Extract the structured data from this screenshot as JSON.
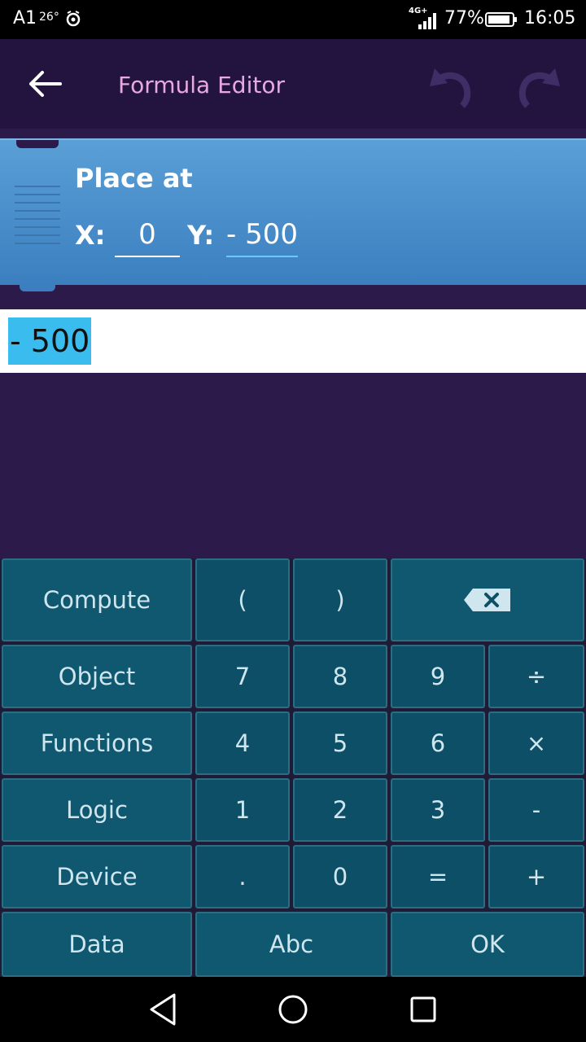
{
  "status_bar": {
    "carrier": "A1",
    "temperature": "26°",
    "network": "4G+",
    "battery_percent": "77%",
    "time": "16:05"
  },
  "app_bar": {
    "title": "Formula Editor",
    "back_icon": "arrow-left-icon",
    "undo_icon": "undo-icon",
    "redo_icon": "redo-icon"
  },
  "brick": {
    "title": "Place at",
    "x_label": "X:",
    "x_value": "0",
    "y_label": "Y:",
    "y_value": "- 500",
    "color": "#4a90cf"
  },
  "formula": {
    "text": "- 500",
    "highlight_color": "#3bbcee"
  },
  "keyboard": {
    "compute": "Compute",
    "paren_open": "(",
    "paren_close": ")",
    "backspace_icon": "backspace-icon",
    "object": "Object",
    "functions": "Functions",
    "logic": "Logic",
    "device": "Device",
    "data": "Data",
    "abc": "Abc",
    "ok": "OK",
    "k7": "7",
    "k8": "8",
    "k9": "9",
    "divide": "÷",
    "k4": "4",
    "k5": "5",
    "k6": "6",
    "multiply": "×",
    "k1": "1",
    "k2": "2",
    "k3": "3",
    "minus": "-",
    "dot": ".",
    "k0": "0",
    "equals": "=",
    "plus": "+",
    "key_color": "#0c4f66"
  },
  "nav_bar": {
    "back_icon": "triangle-back-icon",
    "home_icon": "circle-home-icon",
    "recent_icon": "square-recent-icon"
  }
}
